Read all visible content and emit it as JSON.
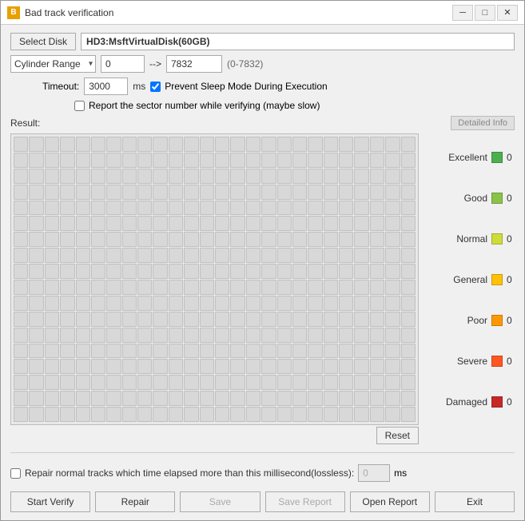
{
  "window": {
    "title": "Bad track verification",
    "icon_label": "B"
  },
  "titlebar": {
    "minimize_label": "─",
    "maximize_label": "□",
    "close_label": "✕"
  },
  "disk_row": {
    "select_disk_label": "Select Disk",
    "disk_name": "HD3:MsftVirtualDisk(60GB)"
  },
  "cylinder_row": {
    "range_type": "Cylinder Range",
    "from_value": "0",
    "arrow": "-->",
    "to_value": "7832",
    "range_hint": "(0-7832)"
  },
  "timeout_row": {
    "label": "Timeout:",
    "value": "3000",
    "unit": "ms",
    "prevent_sleep_label": "Prevent Sleep Mode During Execution",
    "prevent_sleep_checked": true
  },
  "report_row": {
    "label": "Report the sector number while verifying (maybe slow)",
    "checked": false
  },
  "result_section": {
    "label": "Result:",
    "detailed_info_label": "Detailed Info"
  },
  "legend": {
    "items": [
      {
        "name": "Excellent",
        "color": "#4caf50",
        "count": "0"
      },
      {
        "name": "Good",
        "color": "#8bc34a",
        "count": "0"
      },
      {
        "name": "Normal",
        "color": "#cddc39",
        "count": "0"
      },
      {
        "name": "General",
        "color": "#ffc107",
        "count": "0"
      },
      {
        "name": "Poor",
        "color": "#ff9800",
        "count": "0"
      },
      {
        "name": "Severe",
        "color": "#ff5722",
        "count": "0"
      },
      {
        "name": "Damaged",
        "color": "#c62828",
        "count": "0"
      }
    ]
  },
  "reset_btn": "Reset",
  "repair_row": {
    "label": "Repair normal tracks which time elapsed more than this millisecond(lossless):",
    "value": "0",
    "unit": "ms",
    "checked": false
  },
  "action_bar": {
    "start_verify": "Start Verify",
    "repair": "Repair",
    "save": "Save",
    "save_report": "Save Report",
    "open_report": "Open Report",
    "exit": "Exit"
  }
}
